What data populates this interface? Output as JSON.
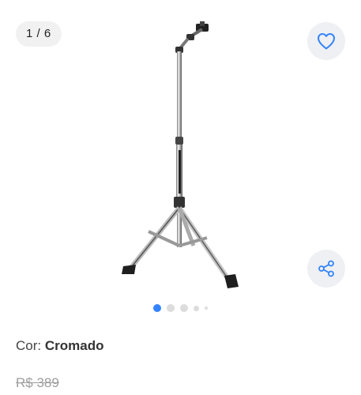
{
  "gallery": {
    "counter": "1 / 6",
    "current_slide": 1,
    "total_slides": 6,
    "favorite_icon": "heart-outline-icon",
    "share_icon": "share-icon",
    "accent_color": "#3483fa"
  },
  "variant": {
    "label": "Cor:",
    "value": "Cromado"
  },
  "price": {
    "original": "R$ 389"
  }
}
